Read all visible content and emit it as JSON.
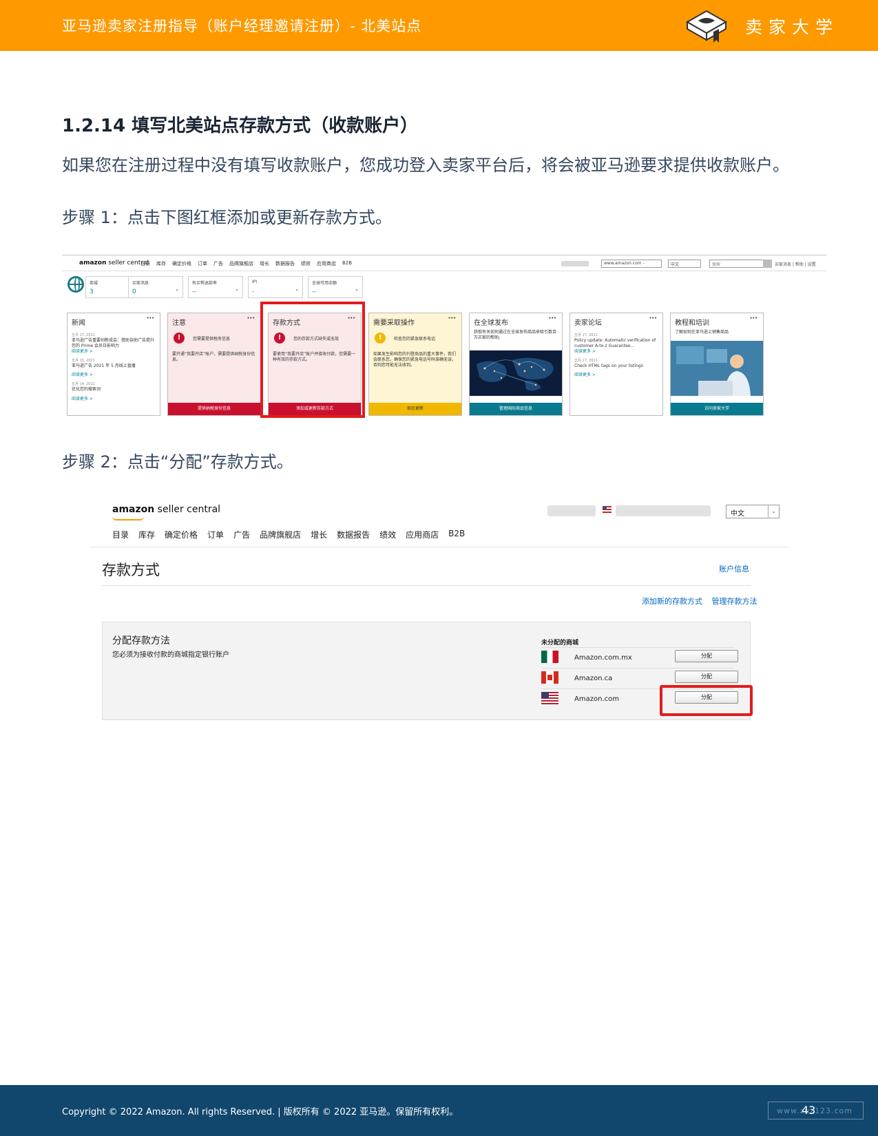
{
  "header": {
    "title": "亚马逊卖家注册指导（账户经理邀请注册）- 北美站点",
    "logo_text": "卖家大学",
    "accent": "#ff9900"
  },
  "section": {
    "heading": "1.2.14 填写北美站点存款方式（收款账户）",
    "intro": "如果您在注册过程中没有填写收款账户，您成功登入卖家平台后，将会被亚马逊要求提供收款账户。",
    "step1": "步骤 1：点击下图红框添加或更新存款方式。",
    "step2": "步骤 2：点击“分配”存款方式。"
  },
  "shot1": {
    "logo_a": "amazon",
    "logo_b": " seller central",
    "nav": [
      "目录",
      "库存",
      "确定价格",
      "订单",
      "广告",
      "品牌旗舰店",
      "增长",
      "数据报告",
      "绩效",
      "应用商店",
      "B2B"
    ],
    "marketplace_select": "www.amazon.com -",
    "lang_select": "中文",
    "search_placeholder": "搜索",
    "util_links": "买家消息 | 帮助 | 设置",
    "dropdowns": [
      {
        "label": "商城",
        "value": "3"
      },
      {
        "label": "买家消息",
        "value": "0"
      },
      {
        "label": "有买帮退款率",
        "value": "--"
      },
      {
        "label": "IPI",
        "value": "-"
      },
      {
        "label": "全球可用余额",
        "value": "--"
      }
    ],
    "cards": {
      "news": {
        "title": "新闻",
        "items": [
          {
            "date": "五月 17, 2021",
            "text": "亚马逊广告重要创新成会：借助自助广告提升您的 Prime 会员日影响力",
            "more": "阅读更多 >"
          },
          {
            "date": "五月 15, 2021",
            "text": "亚马逊广告 2021 年 5 月线上直播",
            "more": "阅读更多 >"
          },
          {
            "date": "五月 14, 2021",
            "text": "优化您的搜索词",
            "more": "阅读更多 >"
          }
        ]
      },
      "notice": {
        "title": "注意",
        "headline": "您需要提供税务信息",
        "body": "要开通“我要开店”账户，需要提供纳税身份信息。",
        "footer": "提供纳税身份信息"
      },
      "deposit": {
        "title": "存款方式",
        "headline": "您的存款方式缺失或无效",
        "body": "要使用“我要开店”账户并接收付款，您需要一种有效的存款方式。",
        "footer": "添加或更新存款方式"
      },
      "action": {
        "title": "需要采取操作",
        "headline": "检查您的紧急联系电话",
        "body": "如果发生影响您的刊登商品的重大事件，我们会联系您。确保您的紧急电话号码准确无误，否则您可能无法收到。",
        "footer": "现在更新"
      },
      "global": {
        "title": "在全球发布",
        "body": "获取有关如何通过在全球发布商品来吸引数百万买家的帮助。",
        "footer": "管理国际商品信息"
      },
      "forum": {
        "title": "卖家论坛",
        "items": [
          {
            "date": "五月 17, 2021",
            "text": "Policy update: Automatic verification of customer A-to-z Guarantee...",
            "more": "阅读更多 >"
          },
          {
            "date": "五月 17, 2021",
            "text": "Check HTML tags on your listings",
            "more": "阅读更多 >"
          }
        ]
      },
      "training": {
        "title": "教程和培训",
        "body": "了解如何在亚马逊上销售商品",
        "footer": "访问卖家大学"
      }
    },
    "colors": {
      "pink_footer": "#c9102e",
      "yellow_footer": "#f0b800",
      "teal_footer": "#0a7b8f",
      "highlight": "#e31b1b"
    }
  },
  "shot2": {
    "logo_a": "amazon",
    "logo_b": " seller central",
    "lang_select": "中文",
    "nav": [
      "目录",
      "库存",
      "确定价格",
      "订单",
      "广告",
      "品牌旗舰店",
      "增长",
      "数据报告",
      "绩效",
      "应用商店",
      "B2B"
    ],
    "page_title": "存款方式",
    "account_info_link": "账户信息",
    "add_link": "添加新的存款方式",
    "manage_link": "管理存款方法",
    "panel_heading": "分配存款方法",
    "panel_sub": "您必须为接收付款的商城指定银行账户",
    "unassigned_label": "未分配的商城",
    "marketplaces": [
      {
        "name": "Amazon.com.mx",
        "button": "分配"
      },
      {
        "name": "Amazon.ca",
        "button": "分配"
      },
      {
        "name": "Amazon.com",
        "button": "分配"
      }
    ]
  },
  "footer": {
    "copyright": "Copyright © 2022 Amazon. All rights Reserved. | 版权所有 © 2022 亚马逊。保留所有权利。",
    "watermark": "www.zuz123.com",
    "page_number": "43",
    "background": "#11476d"
  }
}
